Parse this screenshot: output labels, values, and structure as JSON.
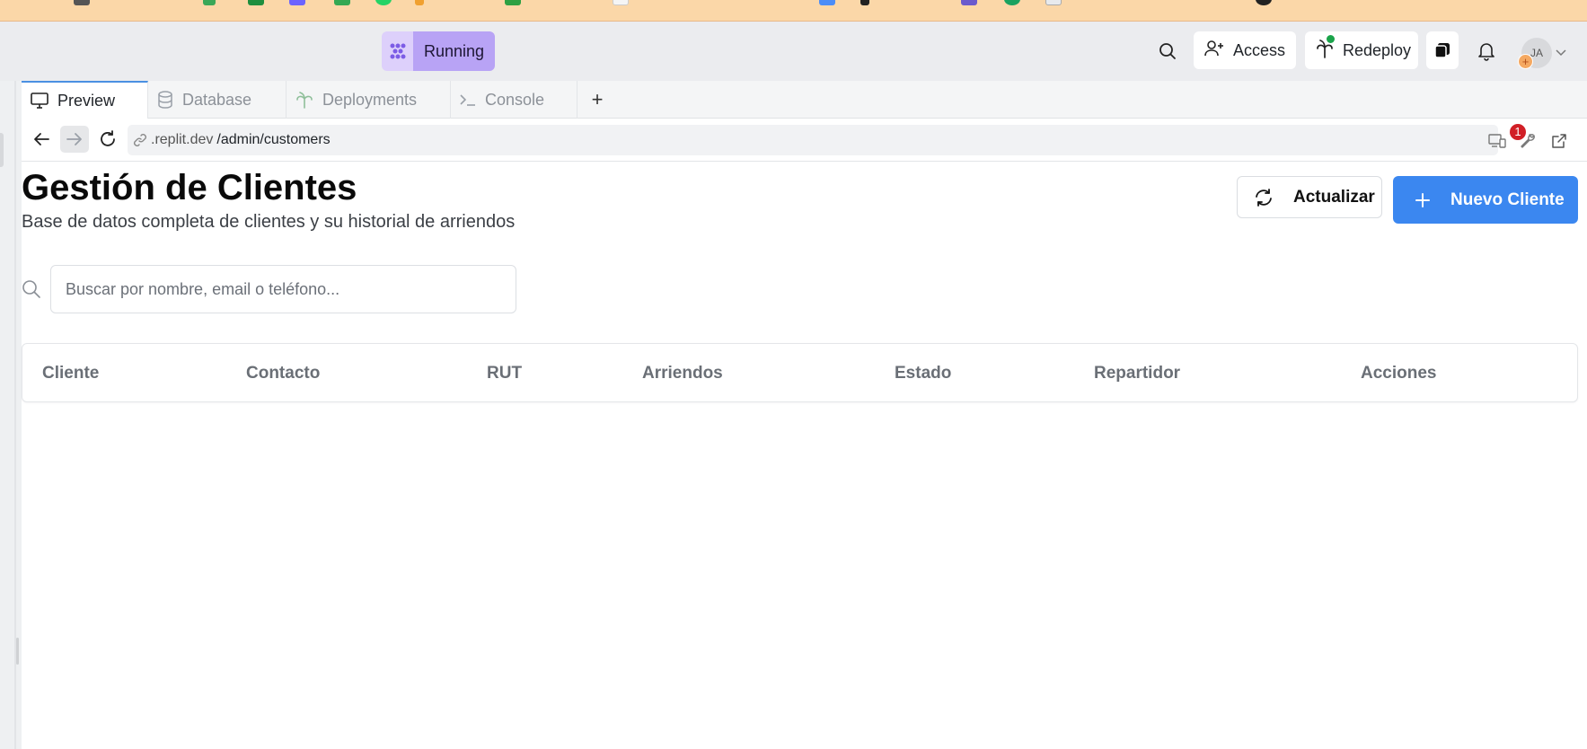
{
  "top": {
    "status_label": "Running",
    "access_label": "Access",
    "redeploy_label": "Redeploy",
    "avatar_initials": "JA",
    "avatar_badge": "+"
  },
  "tabs": [
    {
      "label": "Preview",
      "icon": "monitor-icon"
    },
    {
      "label": "Database",
      "icon": "database-icon"
    },
    {
      "label": "Deployments",
      "icon": "deployments-icon"
    },
    {
      "label": "Console",
      "icon": "console-icon"
    }
  ],
  "tab_add_label": "+",
  "url": {
    "domain": ".replit.dev",
    "path": "/admin/customers",
    "notification_count": "1"
  },
  "page": {
    "title": "Gestión de Clientes",
    "subtitle": "Base de datos completa de clientes y su historial de arriendos",
    "refresh_label": "Actualizar",
    "new_label": "Nuevo Cliente",
    "search_placeholder": "Buscar por nombre, email o teléfono..."
  },
  "table": {
    "columns": [
      "Cliente",
      "Contacto",
      "RUT",
      "Arriendos",
      "Estado",
      "Repartidor",
      "Acciones"
    ]
  },
  "colors": {
    "accent": "#3b87f0",
    "running": "#b8a3f5",
    "badge": "#d11f26"
  }
}
